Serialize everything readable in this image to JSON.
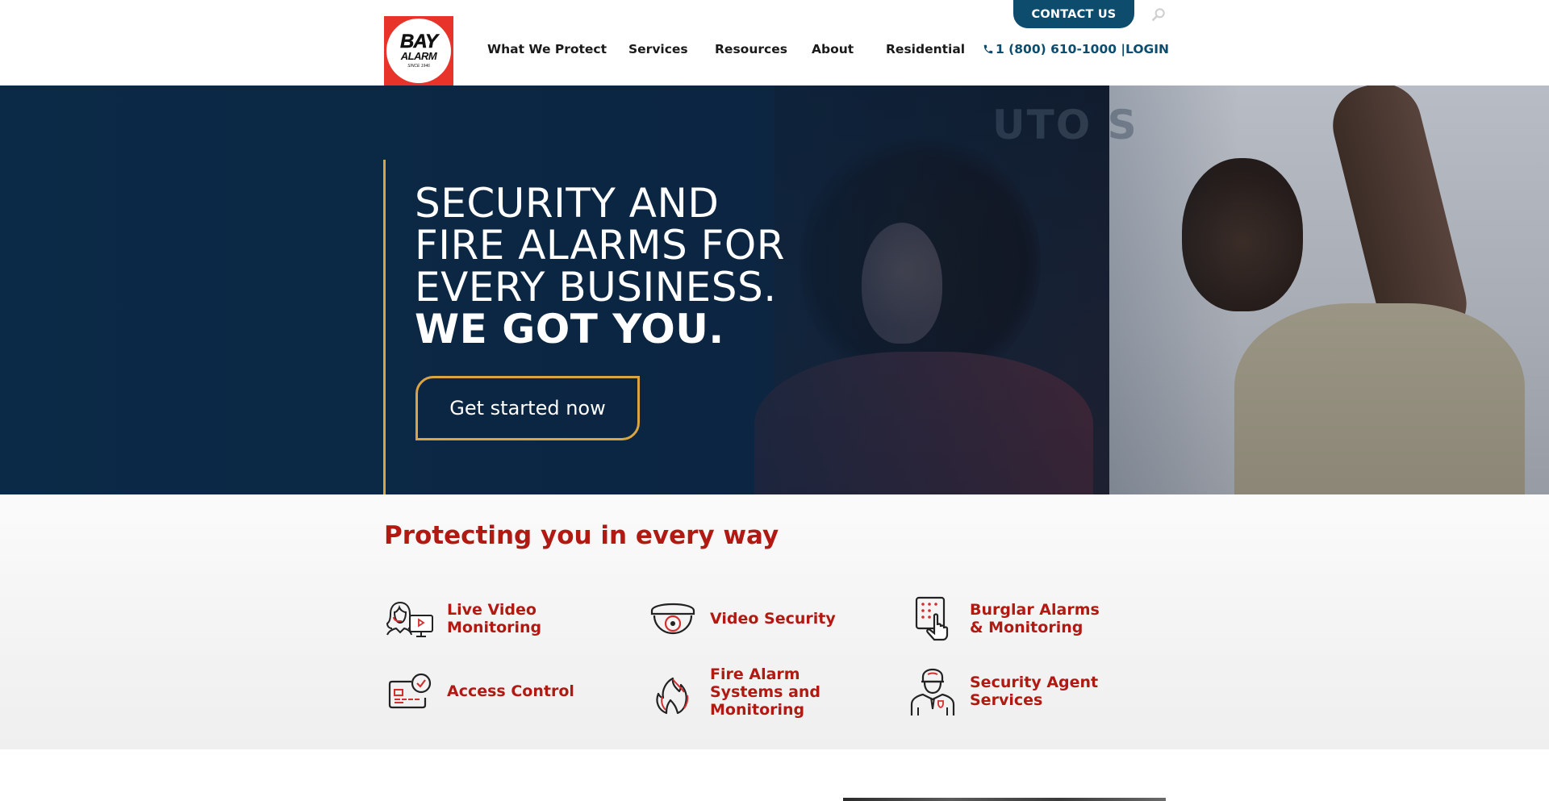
{
  "header": {
    "logo": {
      "line1": "BAY",
      "line2": "ALARM",
      "tagline": "SINCE 1946"
    },
    "nav": [
      {
        "label": "What We Protect"
      },
      {
        "label": "Services"
      },
      {
        "label": "Resources"
      },
      {
        "label": "About"
      },
      {
        "label": "Residential"
      }
    ],
    "phone": "1 (800) 610-1000 |",
    "login": "LOGIN",
    "contact_button": "CONTACT US",
    "search_icon": "search-icon"
  },
  "hero": {
    "title_lines": [
      "SECURITY AND",
      "FIRE ALARMS FOR",
      "EVERY BUSINESS."
    ],
    "title_strong": "WE GOT YOU.",
    "cta": "Get started now",
    "sign_text": "UTO S"
  },
  "services": {
    "title": "Protecting you in every way",
    "items": [
      {
        "label": "Live Video Monitoring",
        "icon": "live-video-monitoring-icon"
      },
      {
        "label": "Video Security",
        "icon": "dome-camera-icon"
      },
      {
        "label": "Burglar Alarms & Monitoring",
        "icon": "keypad-icon"
      },
      {
        "label": "Access Control",
        "icon": "access-card-icon"
      },
      {
        "label": "Fire Alarm Systems and Monitoring",
        "icon": "flame-icon"
      },
      {
        "label": "Security Agent Services",
        "icon": "security-guard-icon"
      }
    ]
  },
  "colors": {
    "brand_red": "#b01a12",
    "logo_red": "#e8332a",
    "navy": "#0e4c6e",
    "hero_bg": "#0b2a47",
    "gold_accent": "#d9a441"
  }
}
